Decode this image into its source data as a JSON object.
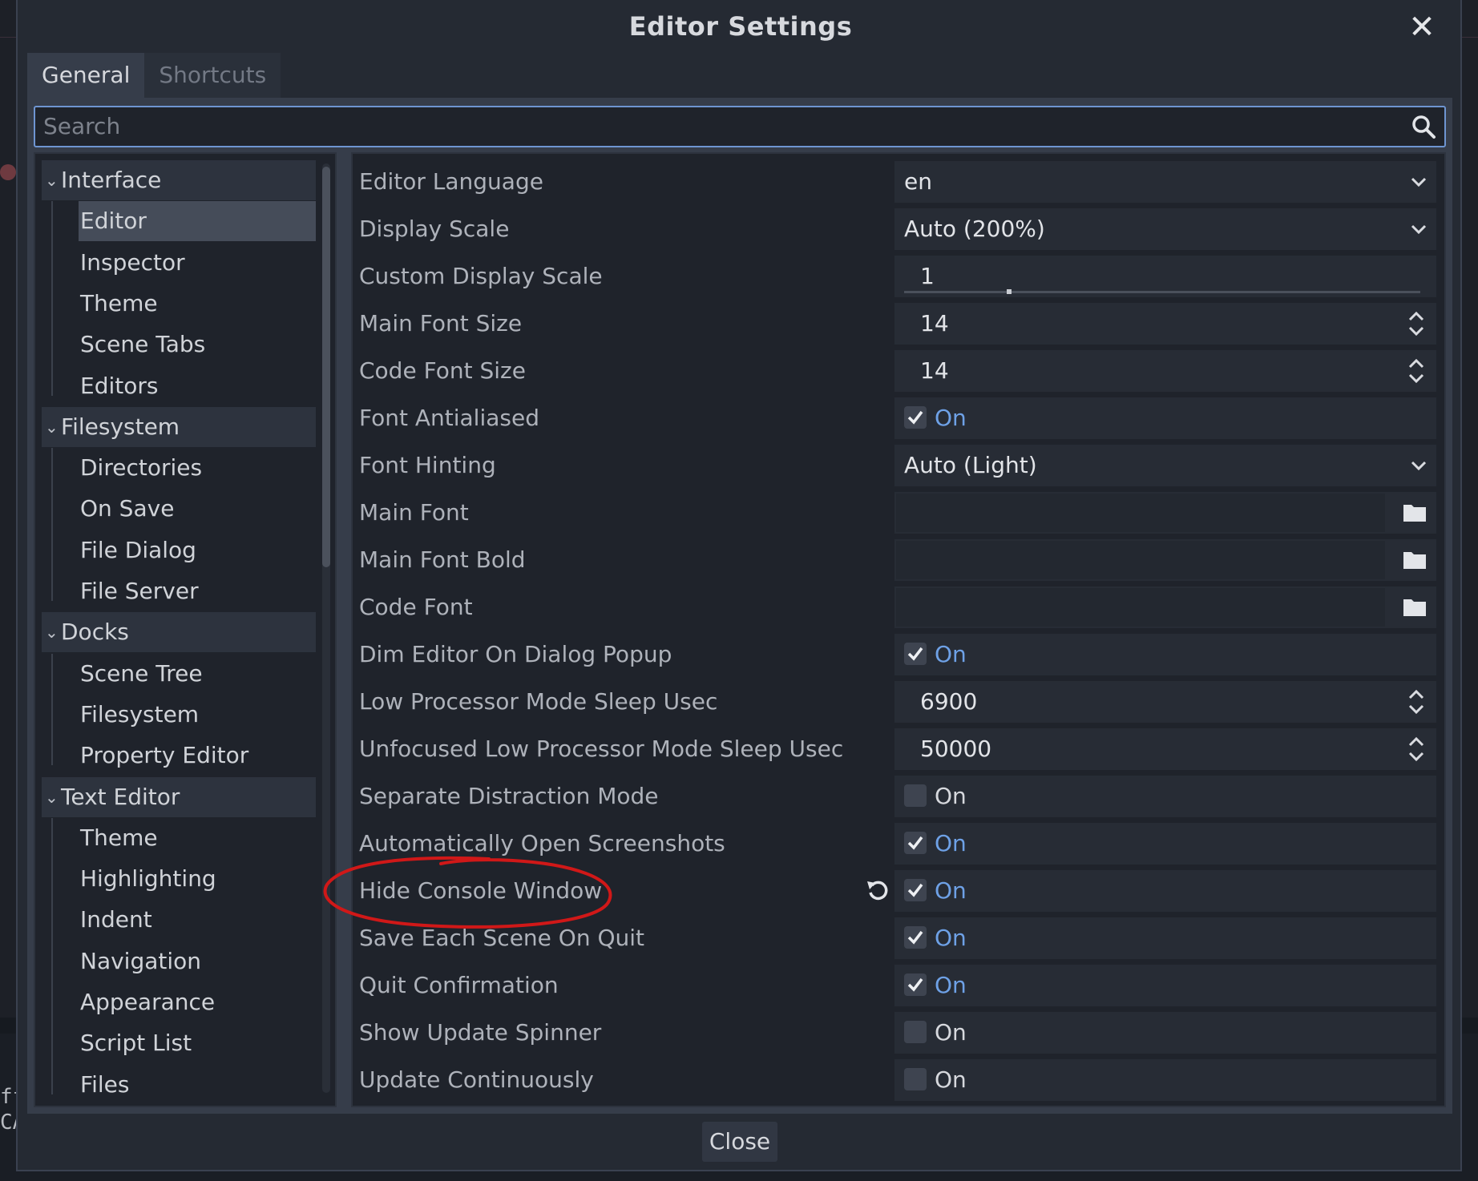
{
  "dialog": {
    "title": "Editor Settings",
    "close_button_label": "Close"
  },
  "tabs": [
    {
      "label": "General",
      "active": true
    },
    {
      "label": "Shortcuts",
      "active": false
    }
  ],
  "search": {
    "placeholder": "Search",
    "value": ""
  },
  "tree": {
    "sections": [
      {
        "label": "Interface",
        "children": [
          "Editor",
          "Inspector",
          "Theme",
          "Scene Tabs",
          "Editors"
        ]
      },
      {
        "label": "Filesystem",
        "children": [
          "Directories",
          "On Save",
          "File Dialog",
          "File Server"
        ]
      },
      {
        "label": "Docks",
        "children": [
          "Scene Tree",
          "Filesystem",
          "Property Editor"
        ]
      },
      {
        "label": "Text Editor",
        "children": [
          "Theme",
          "Highlighting",
          "Indent",
          "Navigation",
          "Appearance",
          "Script List",
          "Files"
        ]
      }
    ],
    "selected": "Editor"
  },
  "settings": [
    {
      "label": "Editor Language",
      "type": "dropdown",
      "value": "en"
    },
    {
      "label": "Display Scale",
      "type": "dropdown",
      "value": "Auto (200%)"
    },
    {
      "label": "Custom Display Scale",
      "type": "slider",
      "value": "1"
    },
    {
      "label": "Main Font Size",
      "type": "spin",
      "value": "14"
    },
    {
      "label": "Code Font Size",
      "type": "spin",
      "value": "14"
    },
    {
      "label": "Font Antialiased",
      "type": "check",
      "checked": true,
      "value": "On"
    },
    {
      "label": "Font Hinting",
      "type": "dropdown",
      "value": "Auto (Light)"
    },
    {
      "label": "Main Font",
      "type": "path",
      "value": ""
    },
    {
      "label": "Main Font Bold",
      "type": "path",
      "value": ""
    },
    {
      "label": "Code Font",
      "type": "path",
      "value": ""
    },
    {
      "label": "Dim Editor On Dialog Popup",
      "type": "check",
      "checked": true,
      "value": "On"
    },
    {
      "label": "Low Processor Mode Sleep Usec",
      "type": "spin",
      "value": "6900"
    },
    {
      "label": "Unfocused Low Processor Mode Sleep Usec",
      "type": "spin",
      "value": "50000"
    },
    {
      "label": "Separate Distraction Mode",
      "type": "check",
      "checked": false,
      "value": "On"
    },
    {
      "label": "Automatically Open Screenshots",
      "type": "check",
      "checked": true,
      "value": "On"
    },
    {
      "label": "Hide Console Window",
      "type": "check",
      "checked": true,
      "value": "On",
      "revertable": true
    },
    {
      "label": "Save Each Scene On Quit",
      "type": "check",
      "checked": true,
      "value": "On"
    },
    {
      "label": "Quit Confirmation",
      "type": "check",
      "checked": true,
      "value": "On"
    },
    {
      "label": "Show Update Spinner",
      "type": "check",
      "checked": false,
      "value": "On"
    },
    {
      "label": "Update Continuously",
      "type": "check",
      "checked": false,
      "value": "On"
    }
  ],
  "background": {
    "left_text_1": "ff",
    "left_text_2": "CA"
  },
  "colors": {
    "accent": "#6e95d1",
    "on_text": "#6ea1e6",
    "annotation": "#d01818"
  },
  "icons": {
    "search": "search-icon",
    "close": "close-icon",
    "folder": "folder-icon",
    "revert": "revert-icon"
  }
}
